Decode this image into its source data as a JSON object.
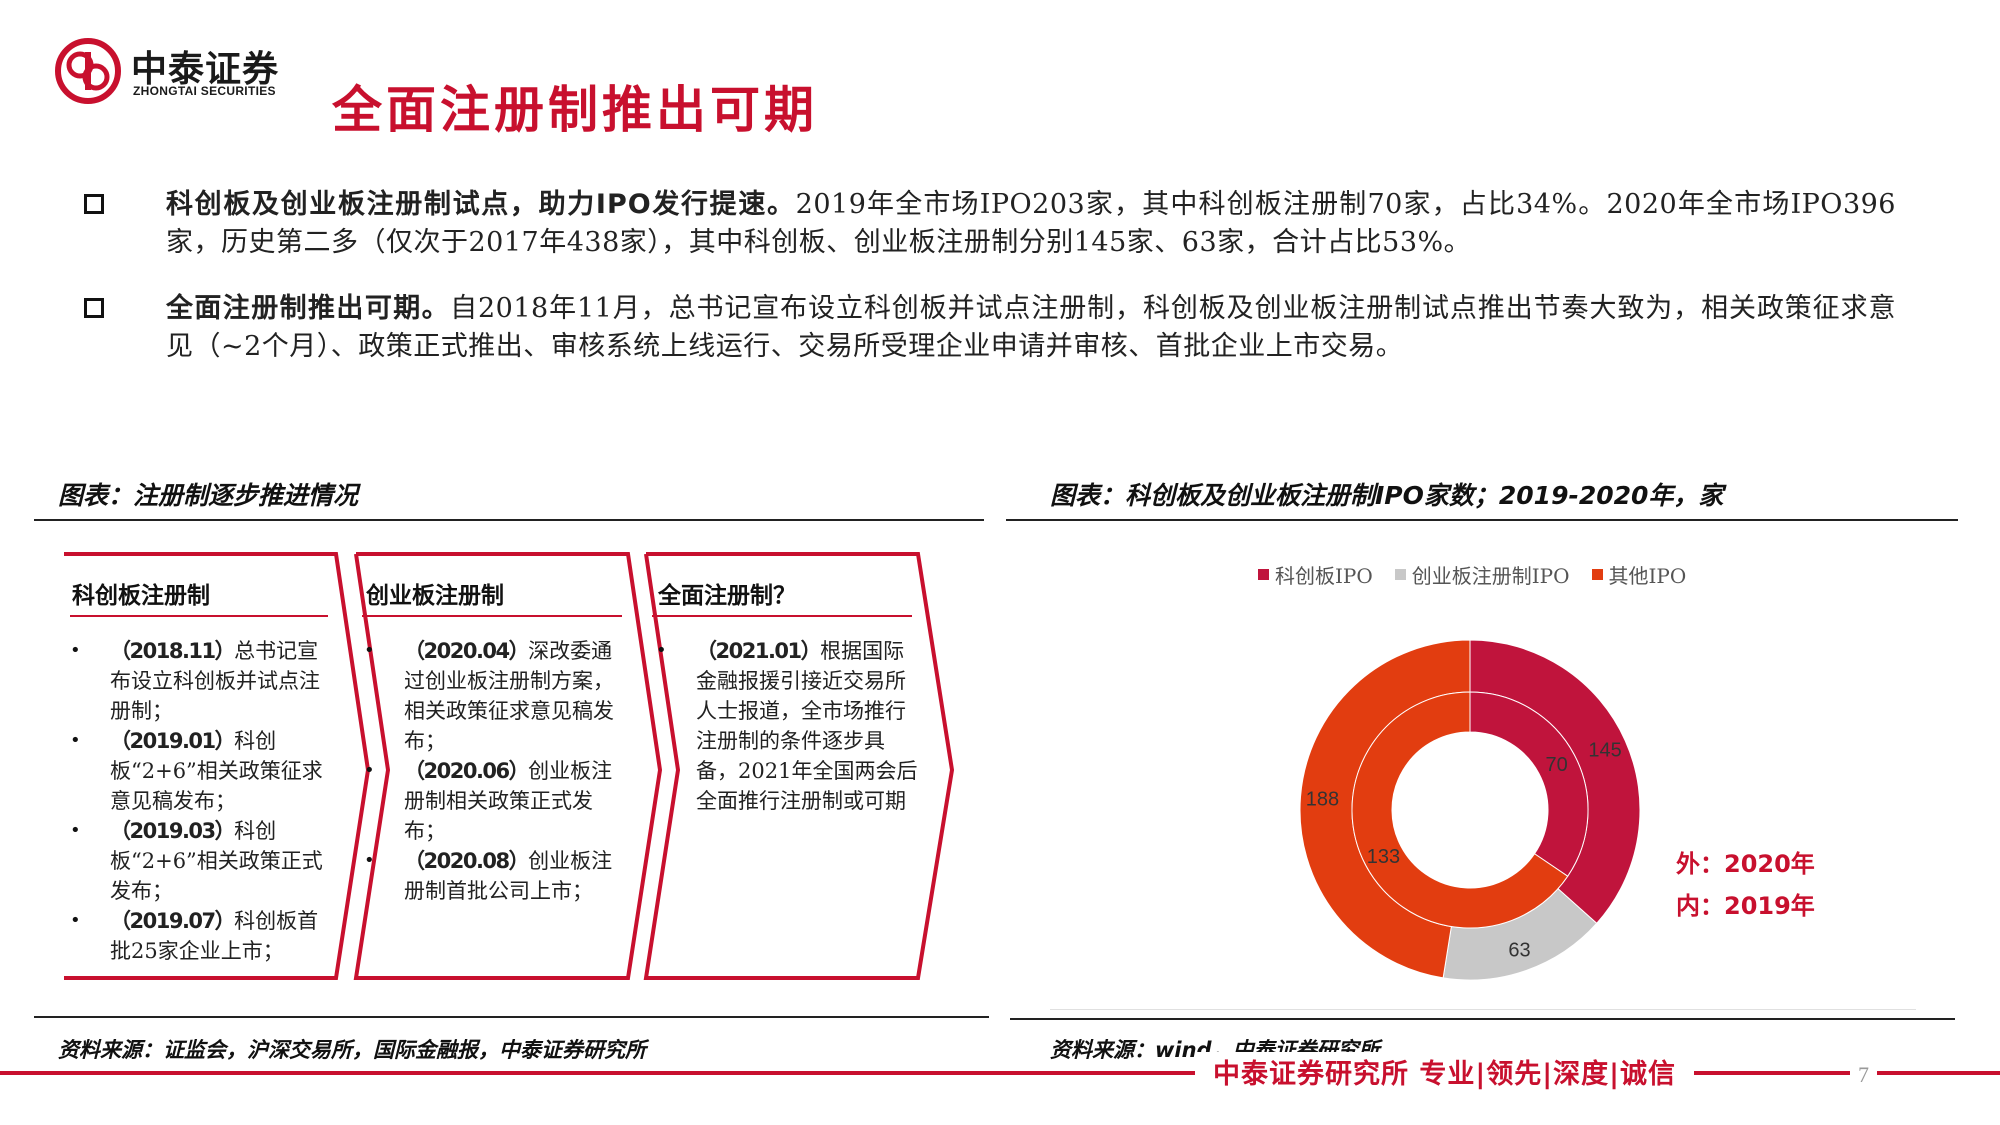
{
  "header": {
    "logo_cn": "中泰证券",
    "logo_en": "ZHONGTAI SECURITIES",
    "title": "全面注册制推出可期",
    "brand_red": "#c8102e"
  },
  "bullets": [
    {
      "lead": "科创板及创业板注册制试点，助力IPO发行提速。",
      "text": "2019年全市场IPO203家，其中科创板注册制70家，占比34%。2020年全市场IPO396家，历史第二多（仅次于2017年438家），其中科创板、创业板注册制分别145家、63家，合计占比53%。"
    },
    {
      "lead": "全面注册制推出可期。",
      "text": "自2018年11月，总书记宣布设立科创板并试点注册制，科创板及创业板注册制试点推出节奏大致为，相关政策征求意见（~2个月）、政策正式推出、审核系统上线运行、交易所受理企业申请并审核、首批企业上市交易。"
    }
  ],
  "left_panel": {
    "title": "图表：注册制逐步推进情况",
    "source": "资料来源：证监会，沪深交易所，国际金融报，中泰证券研究所",
    "stages": [
      {
        "heading": "科创板注册制",
        "items": [
          {
            "date": "（2018.11）",
            "text": "总书记宣布设立科创板并试点注册制；"
          },
          {
            "date": "（2019.01）",
            "text": "科创板“2+6”相关政策征求意见稿发布；"
          },
          {
            "date": "（2019.03）",
            "text": "科创板“2+6”相关政策正式发布；"
          },
          {
            "date": "（2019.07）",
            "text": "科创板首批25家企业上市；"
          }
        ]
      },
      {
        "heading": "创业板注册制",
        "items": [
          {
            "date": "（2020.04）",
            "text": "深改委通过创业板注册制方案，相关政策征求意见稿发布；"
          },
          {
            "date": "（2020.06）",
            "text": "创业板注册制相关政策正式发布；"
          },
          {
            "date": "（2020.08）",
            "text": "创业板注册制首批公司上市；"
          }
        ]
      },
      {
        "heading": "全面注册制？",
        "items": [
          {
            "date": "（2021.01）",
            "text": "根据国际金融报援引接近交易所人士报道，全市场推行注册制的条件逐步具备，2021年全国两会后全面推行注册制或可期"
          }
        ]
      }
    ]
  },
  "right_panel": {
    "title": "图表：科创板及创业板注册制IPO家数；2019-2020年，家",
    "source": "资料来源：wind，中泰证券研究所",
    "annotation_outer": "外：2020年",
    "annotation_inner": "内：2019年"
  },
  "chart_data": {
    "type": "pie",
    "variant": "nested-donut",
    "title": "",
    "legend": [
      "科创板IPO",
      "创业板注册制IPO",
      "其他IPO"
    ],
    "legend_position": "top",
    "colors": {
      "科创板IPO": "#c0143c",
      "创业板注册制IPO": "#c8c8c8",
      "其他IPO": "#e23d10"
    },
    "rings": [
      {
        "name": "2020年",
        "position": "outer",
        "slices": [
          {
            "label": "科创板IPO",
            "value": 145
          },
          {
            "label": "创业板注册制IPO",
            "value": 63
          },
          {
            "label": "其他IPO",
            "value": 188
          }
        ]
      },
      {
        "name": "2019年",
        "position": "inner",
        "slices": [
          {
            "label": "科创板IPO",
            "value": 70
          },
          {
            "label": "其他IPO",
            "value": 133
          }
        ]
      }
    ]
  },
  "footer": {
    "slogan": "中泰证券研究所 专业|领先|深度|诚信",
    "page": "7"
  }
}
